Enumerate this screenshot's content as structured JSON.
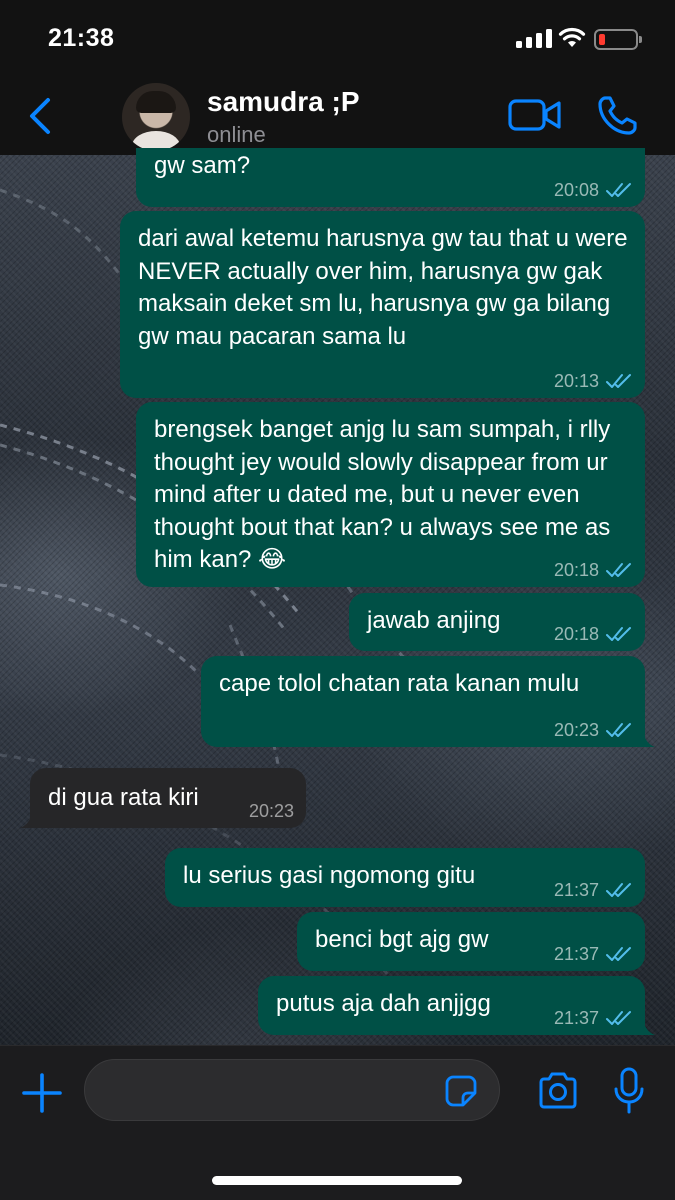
{
  "status_bar": {
    "time": "21:38"
  },
  "header": {
    "back_icon": "chevron-left-icon",
    "contact_name": "samudra ;P",
    "contact_status": "online",
    "video_icon": "video-camera-icon",
    "phone_icon": "phone-icon"
  },
  "colors": {
    "accent": "#0a84ff",
    "outgoing_bubble": "#005046",
    "incoming_bubble": "#262628",
    "read_ticks": "#53bdeb",
    "battery_low": "#ff3b30"
  },
  "messages": [
    {
      "direction": "out",
      "text": "gw sam?",
      "time": "20:08",
      "status": "read"
    },
    {
      "direction": "out",
      "text": "dari awal ketemu harusnya gw tau that u were NEVER actually over him, harusnya gw gak maksain deket sm lu, harusnya gw ga bilang gw mau pacaran sama lu",
      "time": "20:13",
      "status": "read"
    },
    {
      "direction": "out",
      "text": "brengsek banget anjg lu sam sumpah, i rlly thought jey would slowly disappear from ur mind after u dated me, but u never even thought bout that kan? u always see me as him kan? 😂",
      "time": "20:18",
      "status": "read"
    },
    {
      "direction": "out",
      "text": "jawab anjing",
      "time": "20:18",
      "status": "read"
    },
    {
      "direction": "out",
      "text": "cape tolol chatan rata kanan mulu",
      "time": "20:23",
      "status": "read"
    },
    {
      "direction": "in",
      "text": "di gua rata kiri",
      "time": "20:23"
    },
    {
      "direction": "out",
      "text": "lu serius gasi ngomong gitu",
      "time": "21:37",
      "status": "read"
    },
    {
      "direction": "out",
      "text": "benci bgt ajg gw",
      "time": "21:37",
      "status": "read"
    },
    {
      "direction": "out",
      "text": "putus aja dah anjjgg",
      "time": "21:37",
      "status": "read"
    }
  ],
  "input_bar": {
    "plus_icon": "plus-icon",
    "message_placeholder": "",
    "sticker_icon": "sticker-icon",
    "camera_icon": "camera-icon",
    "mic_icon": "microphone-icon"
  }
}
